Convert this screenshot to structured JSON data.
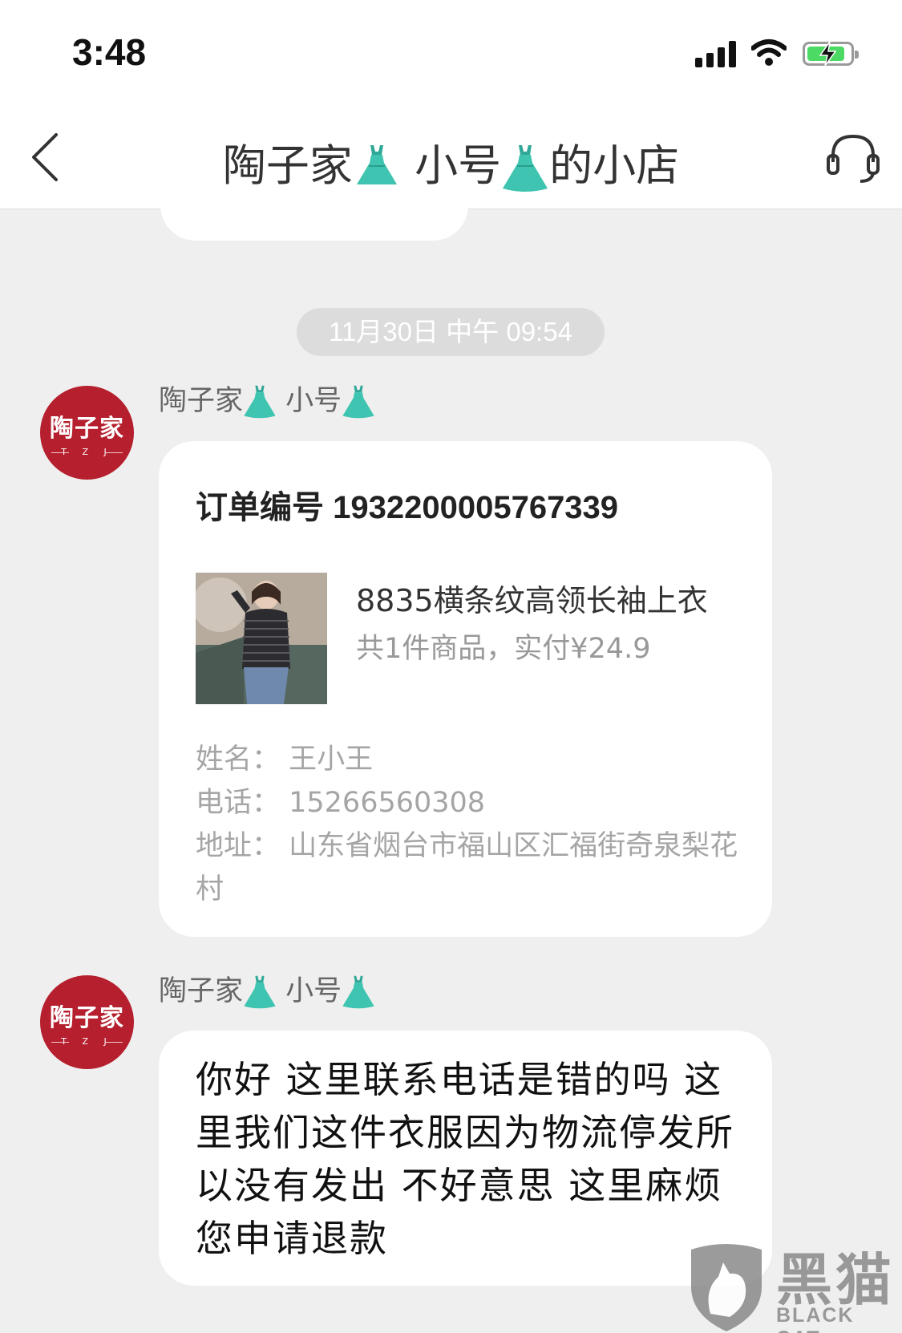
{
  "status_bar": {
    "time": "3:48",
    "icons": [
      "signal-icon",
      "wifi-icon",
      "battery-charging-icon"
    ]
  },
  "header": {
    "title_part1": "陶子家",
    "title_part2": " 小号",
    "title_part3": "的小店",
    "back_icon": "chevron-left-icon",
    "service_icon": "headset-icon"
  },
  "chat": {
    "timestamp": "11月30日 中午 09:54",
    "sender_name_a": "陶子家",
    "sender_name_b": " 小号",
    "avatar_text": "陶子家",
    "avatar_sub": "T Z J",
    "order_card": {
      "order_label": "订单编号 1932200005767339",
      "product_title": "8835横条纹高领长袖上衣",
      "product_summary": "共1件商品，实付¥24.9",
      "name_line": "姓名：  王小王",
      "phone_line": "电话：  15266560308",
      "address_line": "地址：  山东省烟台市福山区汇福街奇泉梨花村"
    },
    "message_text": "你好 这里联系电话是错的吗 这里我们这件衣服因为物流停发所以没有发出 不好意思 这里麻烦您申请退款"
  },
  "watermark": {
    "title": "黑猫",
    "subtitle": "BLACK CAT"
  },
  "colors": {
    "avatar_red": "#b51f2e",
    "dress_teal": "#3ec4b0",
    "background": "#efefef"
  }
}
